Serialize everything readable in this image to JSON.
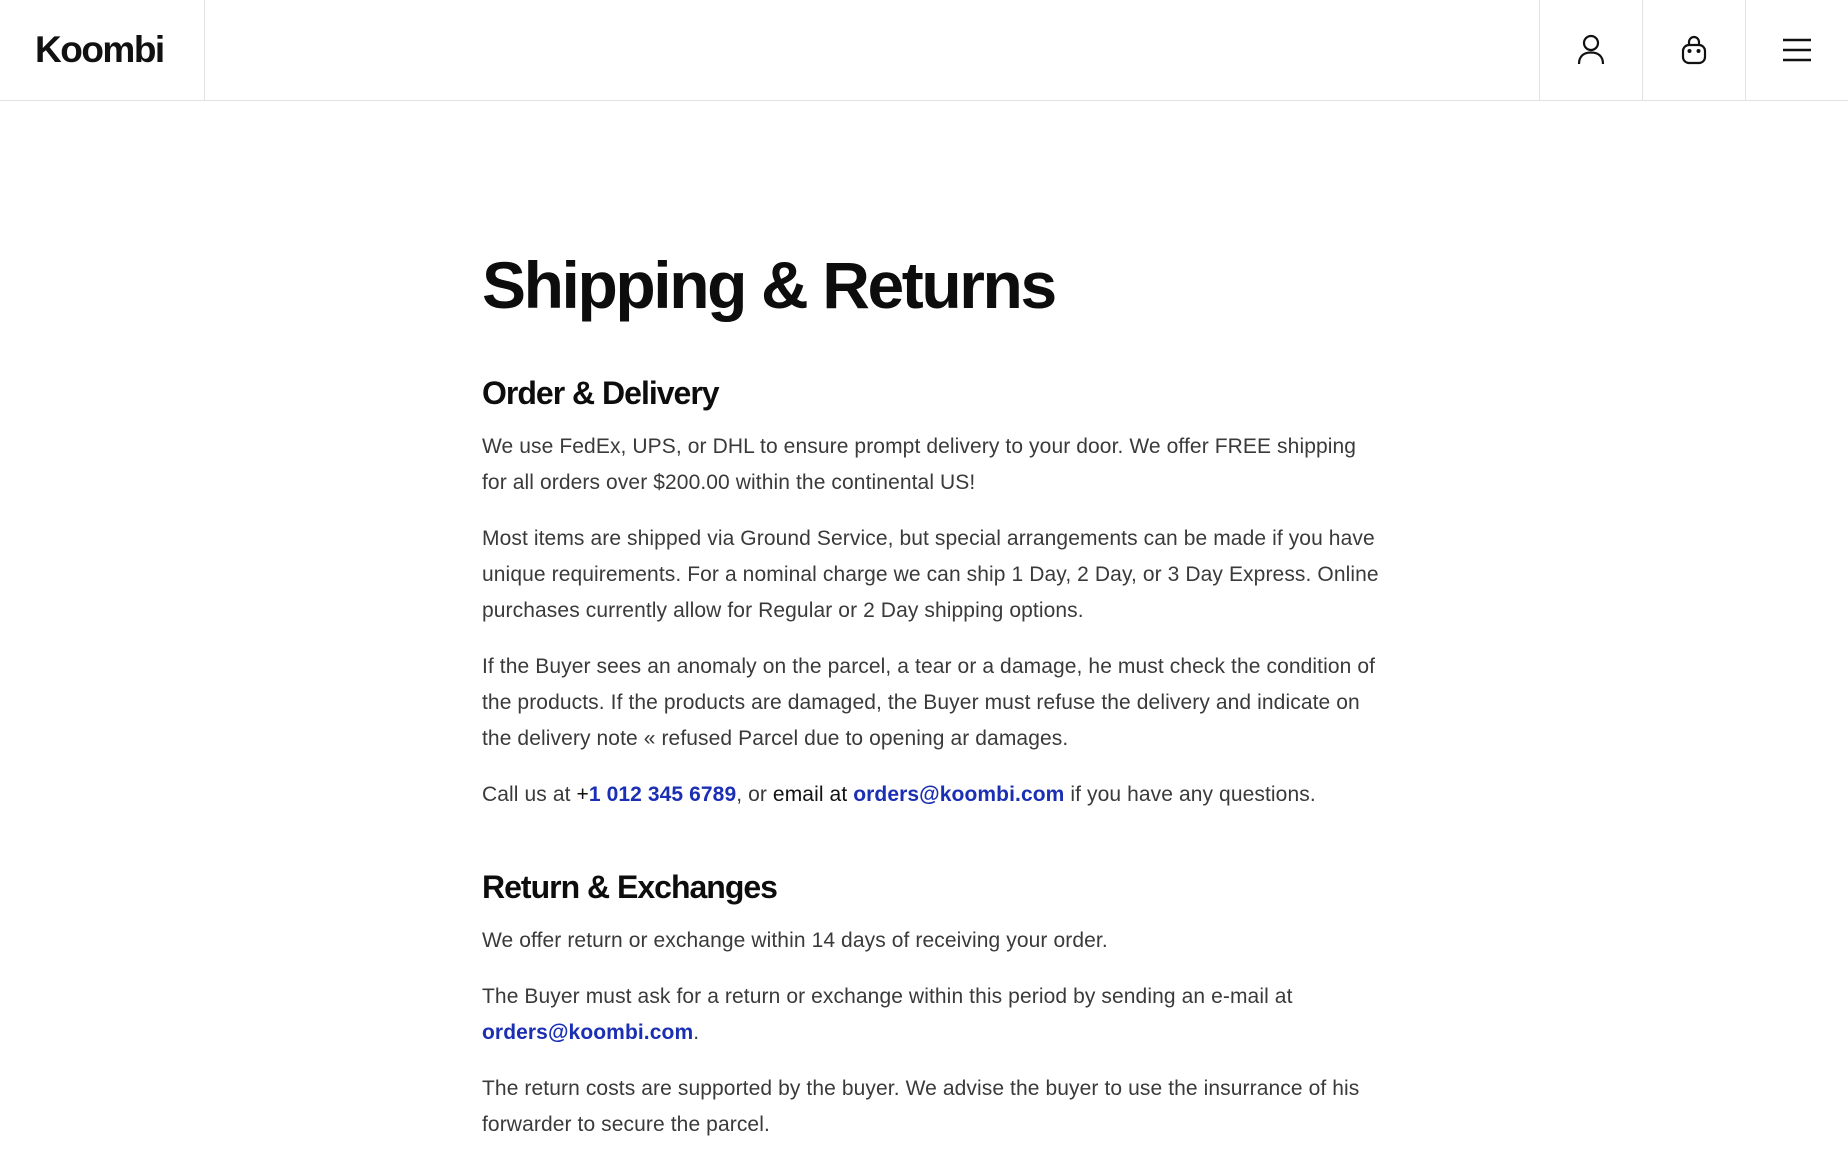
{
  "header": {
    "logo": "Koombi",
    "account_icon": "user-icon",
    "cart_icon": "shopping-bag-icon",
    "menu_icon": "hamburger-menu-icon"
  },
  "page": {
    "title": "Shipping & Returns"
  },
  "order_delivery": {
    "title": "Order & Delivery",
    "p1": "We use FedEx, UPS, or DHL to ensure prompt delivery to your door. We offer FREE shipping for all orders over $200.00 within the continental US!",
    "p2": "Most items are shipped via Ground Service, but special arrangements can be made if you have unique requirements. For a nominal charge we can ship 1 Day, 2 Day, or 3 Day Express. Online purchases currently allow for Regular or 2 Day shipping options.",
    "p3": "If the Buyer sees an anomaly on the parcel, a tear or a damage, he must check the condition of the products. If the products are damaged, the Buyer must refuse the delivery and indicate on the delivery note « refused Parcel due to opening ar damages.",
    "contact": {
      "prefix": "Call us at ",
      "plus": "+",
      "phone": "1 012 345 6789",
      "mid": ", or ",
      "email_label": "email at",
      "space": " ",
      "email": "orders@koombi.com",
      "suffix": " if you have any questions."
    }
  },
  "returns": {
    "title": "Return & Exchanges",
    "p1": "We offer return or exchange within 14 days of receiving your order.",
    "p2_text": "The Buyer must ask for a return or exchange within this period by sending an e-mail at ",
    "p2_email": "orders@koombi.com",
    "p2_end": ".",
    "p3": "The return costs are supported by the buyer. We advise the buyer to use the insurrance of his forwarder to secure the parcel."
  },
  "colors": {
    "link": "#1a2fb3",
    "text": "#3a3a3a",
    "heading": "#0d0d0d",
    "border": "#e2e2e2"
  }
}
